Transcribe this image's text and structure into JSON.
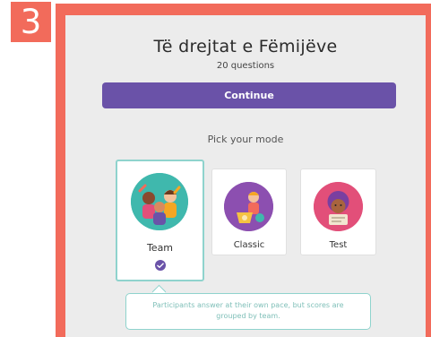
{
  "step": {
    "number": "3"
  },
  "header": {
    "title": "Të drejtat e Fëmijëve",
    "subtitle": "20 questions"
  },
  "actions": {
    "continue_label": "Continue"
  },
  "modes": {
    "heading": "Pick your mode",
    "options": [
      {
        "label": "Team",
        "selected": true
      },
      {
        "label": "Classic",
        "selected": false
      },
      {
        "label": "Test",
        "selected": false
      }
    ],
    "description": "Participants answer at their own pace, but scores are grouped by team."
  },
  "colors": {
    "accent": "#6a52a8",
    "frame": "#f26b5b",
    "selection": "#8fd3cd",
    "team_avatar": "#3fb8ad",
    "classic_avatar": "#8c4fb0",
    "test_avatar": "#e24f79"
  }
}
